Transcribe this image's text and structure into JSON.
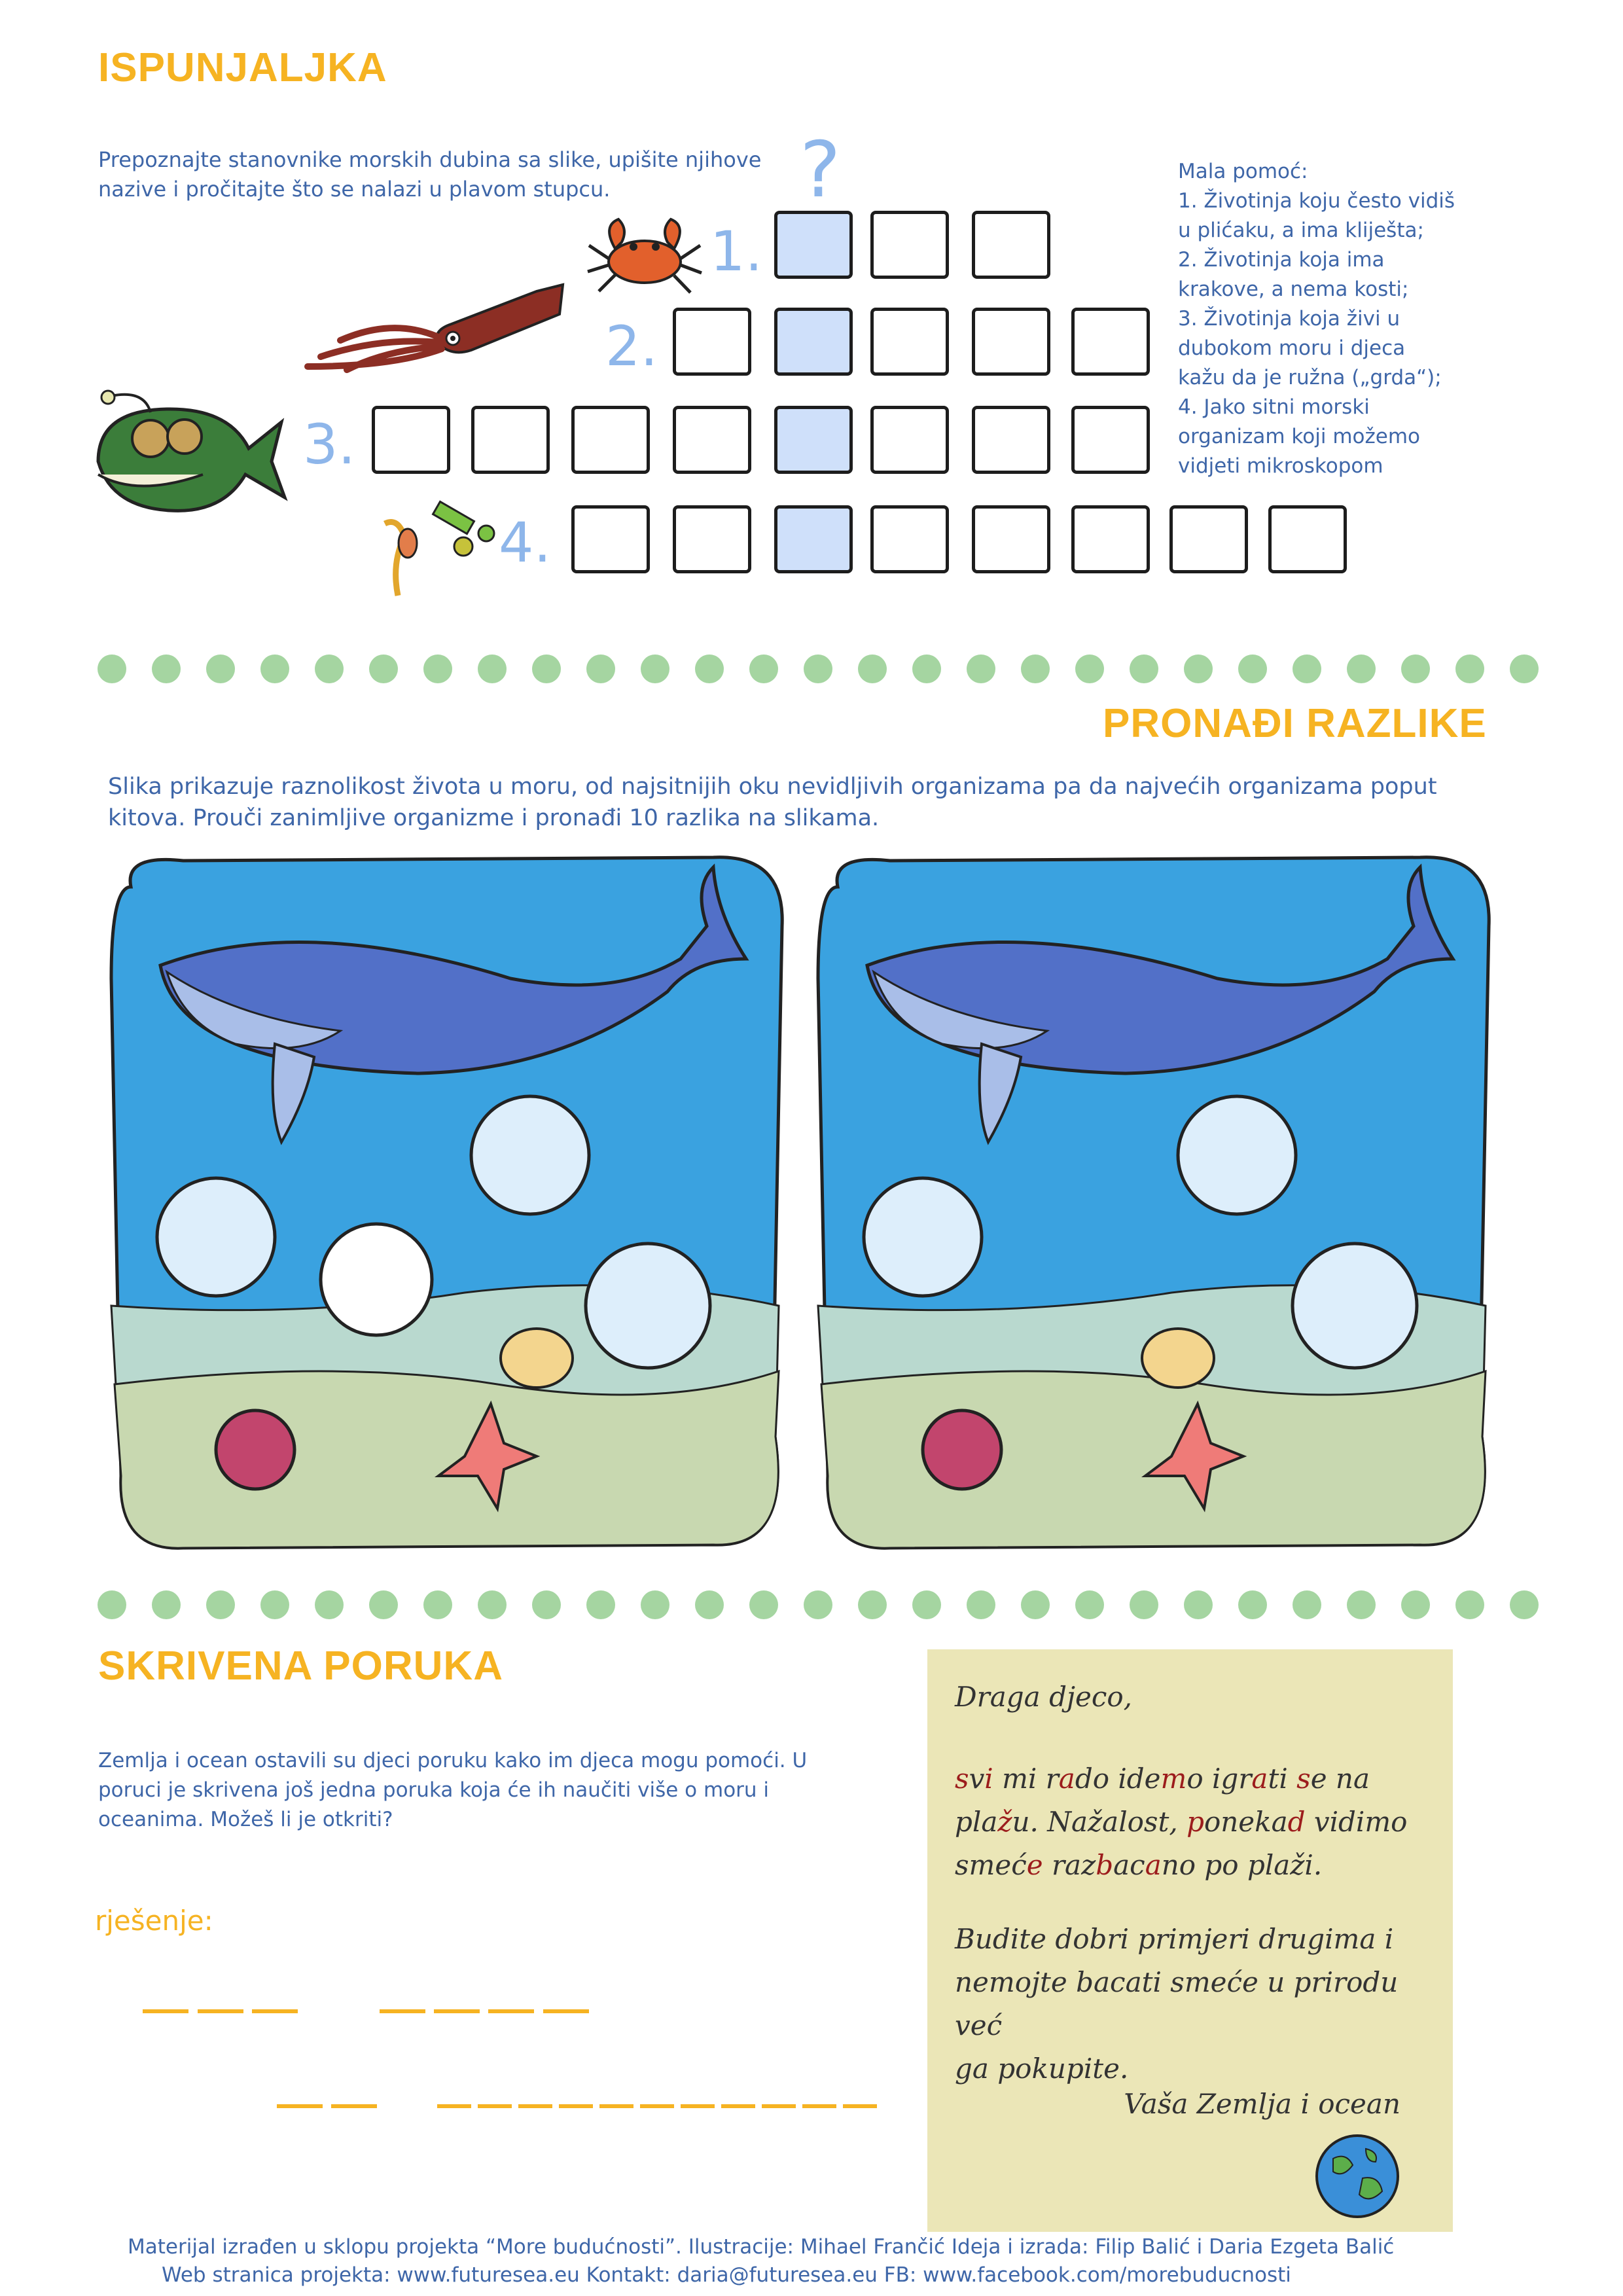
{
  "crossword": {
    "title": "ISPUNJALJKA",
    "instruction": "Prepoznajte stanovnike morskih dubina sa slike, upišite njihove nazive i pročitajte što se nalazi u plavom stupcu.",
    "question_mark": "?",
    "row_labels": [
      "1.",
      "2.",
      "3.",
      "4."
    ],
    "hint_title": "Mala pomoć:",
    "hints": [
      "1. Životinja koju često vidiš",
      "u plićaku, a ima kliješta;",
      "2. Životinja koja ima",
      "krakove, a nema kosti;",
      "3. Životinja koja živi u",
      "dubokom moru i djeca",
      "kažu da je ružna („grda“);",
      "4. Jako sitni morski",
      "organizam koji možemo",
      "vidjeti mikroskopom"
    ]
  },
  "differences": {
    "title": "PRONAĐI RAZLIKE",
    "instruction_line1": "Slika prikazuje raznolikost života u moru, od najsitnijih oku nevidljivih organizama pa da najvećih organizama poput",
    "instruction_line2": "kitova. Prouči zanimljive organizme i pronađi 10 razlika na slikama."
  },
  "hidden_message": {
    "title": "SKRIVENA PORUKA",
    "instruction_line1": "Zemlja i ocean ostavili su djeci poruku kako im djeca mogu pomoći. U",
    "instruction_line2": "poruci je skrivena još jedna poruka koja će ih naučiti više o moru i",
    "instruction_line3": "oceanima. Možeš li je otkriti?",
    "solution_label": "rješenje:",
    "letter": {
      "greeting": "Draga djeco,",
      "paragraph2_line1": "Budite dobri primjeri drugima i",
      "paragraph2_line2": "nemojte bacati smeće u prirodu već",
      "paragraph2_line3": "ga pokupite.",
      "signature": "Vaša Zemlja i ocean"
    }
  },
  "footer": {
    "line1": "Materijal izrađen u sklopu projekta “More budućnosti”. Ilustracije: Mihael Frančić  Ideja i izrada: Filip Balić i Daria Ezgeta Balić",
    "line2": "Web stranica projekta: www.futuresea.eu  Kontakt: daria@futuresea.eu FB: www.facebook.com/morebuducnosti"
  },
  "colors": {
    "title": "#f6b322",
    "text": "#3e66a8",
    "highlight_column": "#cfe0fa",
    "dots": "#a5d5a1",
    "message_box": "#ebe6b7",
    "hidden_letters": "#9c1c1c"
  }
}
